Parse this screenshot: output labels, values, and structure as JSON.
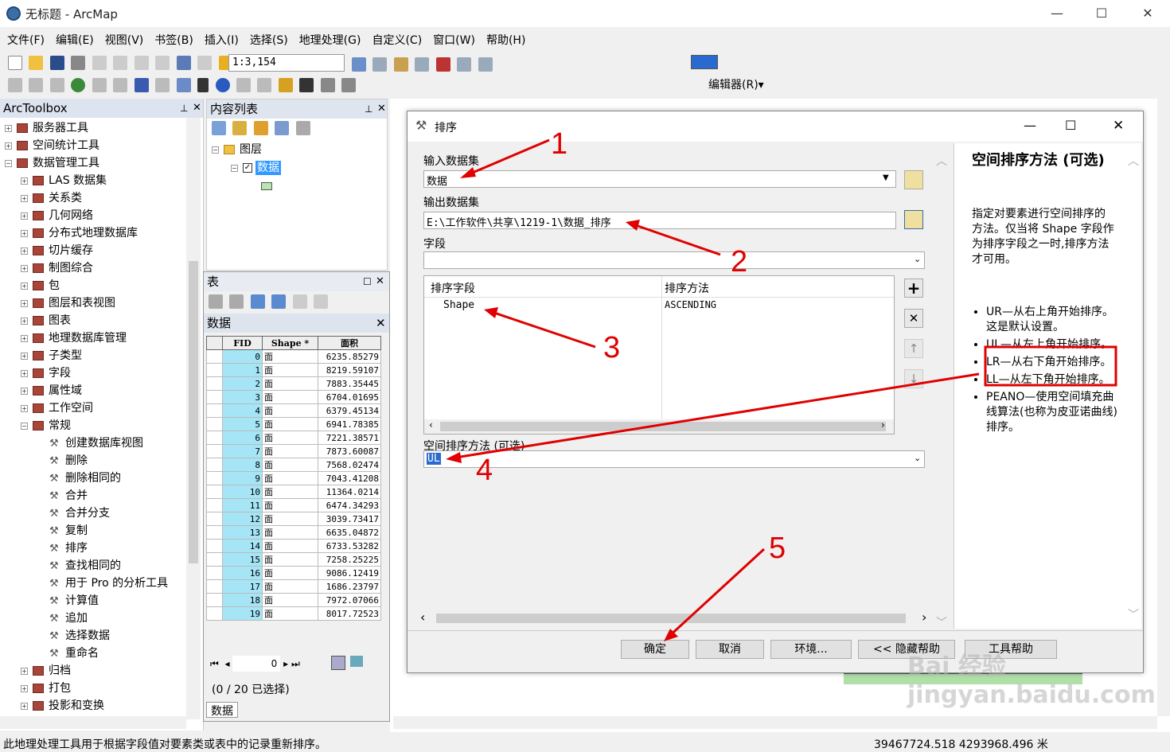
{
  "window": {
    "title": "无标题 - ArcMap",
    "min": "—",
    "max": "☐",
    "close": "✕"
  },
  "menu": [
    "文件(F)",
    "编辑(E)",
    "视图(V)",
    "书签(B)",
    "插入(I)",
    "选择(S)",
    "地理处理(G)",
    "自定义(C)",
    "窗口(W)",
    "帮助(H)"
  ],
  "toolbar": {
    "scale": "1:3,154",
    "editor": "编辑器(R)▾"
  },
  "toolbox": {
    "title": "ArcToolbox",
    "items": [
      {
        "label": "服务器工具",
        "kind": "box",
        "exp": "+"
      },
      {
        "label": "空间统计工具",
        "kind": "box",
        "exp": "+"
      },
      {
        "label": "数据管理工具",
        "kind": "box",
        "exp": "−"
      },
      {
        "label": "LAS 数据集",
        "kind": "box",
        "exp": "+"
      },
      {
        "label": "关系类",
        "kind": "box",
        "exp": "+"
      },
      {
        "label": "几何网络",
        "kind": "box",
        "exp": "+"
      },
      {
        "label": "分布式地理数据库",
        "kind": "box",
        "exp": "+"
      },
      {
        "label": "切片缓存",
        "kind": "box",
        "exp": "+"
      },
      {
        "label": "制图综合",
        "kind": "box",
        "exp": "+"
      },
      {
        "label": "包",
        "kind": "box",
        "exp": "+"
      },
      {
        "label": "图层和表视图",
        "kind": "box",
        "exp": "+"
      },
      {
        "label": "图表",
        "kind": "box",
        "exp": "+"
      },
      {
        "label": "地理数据库管理",
        "kind": "box",
        "exp": "+"
      },
      {
        "label": "子类型",
        "kind": "box",
        "exp": "+"
      },
      {
        "label": "字段",
        "kind": "box",
        "exp": "+"
      },
      {
        "label": "属性域",
        "kind": "box",
        "exp": "+"
      },
      {
        "label": "工作空间",
        "kind": "box",
        "exp": "+"
      },
      {
        "label": "常规",
        "kind": "box",
        "exp": "−"
      },
      {
        "label": "创建数据库视图",
        "kind": "tool"
      },
      {
        "label": "删除",
        "kind": "tool"
      },
      {
        "label": "删除相同的",
        "kind": "tool"
      },
      {
        "label": "合并",
        "kind": "tool"
      },
      {
        "label": "合并分支",
        "kind": "tool"
      },
      {
        "label": "复制",
        "kind": "tool"
      },
      {
        "label": "排序",
        "kind": "tool"
      },
      {
        "label": "查找相同的",
        "kind": "tool"
      },
      {
        "label": "用于 Pro 的分析工具",
        "kind": "tool"
      },
      {
        "label": "计算值",
        "kind": "tool"
      },
      {
        "label": "追加",
        "kind": "tool"
      },
      {
        "label": "选择数据",
        "kind": "tool"
      },
      {
        "label": "重命名",
        "kind": "tool"
      },
      {
        "label": "归档",
        "kind": "box",
        "exp": "+"
      },
      {
        "label": "打包",
        "kind": "box",
        "exp": "+"
      },
      {
        "label": "投影和变换",
        "kind": "box",
        "exp": "+"
      }
    ]
  },
  "toc": {
    "title": "内容列表",
    "layers": "图层",
    "layer": "数据"
  },
  "table": {
    "title": "表",
    "tab_title": "数据",
    "columns": [
      "FID",
      "Shape *",
      "面积"
    ],
    "rows": [
      [
        "0",
        "面",
        "6235.85279"
      ],
      [
        "1",
        "面",
        "8219.59107"
      ],
      [
        "2",
        "面",
        "7883.35445"
      ],
      [
        "3",
        "面",
        "6704.01695"
      ],
      [
        "4",
        "面",
        "6379.45134"
      ],
      [
        "5",
        "面",
        "6941.78385"
      ],
      [
        "6",
        "面",
        "7221.38571"
      ],
      [
        "7",
        "面",
        "7873.60087"
      ],
      [
        "8",
        "面",
        "7568.02474"
      ],
      [
        "9",
        "面",
        "7043.41208"
      ],
      [
        "10",
        "面",
        "11364.0214"
      ],
      [
        "11",
        "面",
        "6474.34293"
      ],
      [
        "12",
        "面",
        "3039.73417"
      ],
      [
        "13",
        "面",
        "6635.04872"
      ],
      [
        "14",
        "面",
        "6733.53282"
      ],
      [
        "15",
        "面",
        "7258.25225"
      ],
      [
        "16",
        "面",
        "9086.12419"
      ],
      [
        "17",
        "面",
        "1686.23797"
      ],
      [
        "18",
        "面",
        "7972.07066"
      ],
      [
        "19",
        "面",
        "8017.72523"
      ]
    ],
    "record": "0",
    "selection": "(0 / 20 已选择)",
    "bottom_tab": "数据"
  },
  "dialog": {
    "title": "排序",
    "input_label": "输入数据集",
    "input_value": "数据",
    "output_label": "输出数据集",
    "output_value": "E:\\工作软件\\共享\\1219-1\\数据_排序",
    "field_label": "字段",
    "sort_col1": "排序字段",
    "sort_col2": "排序方法",
    "sort_field": "Shape",
    "sort_method": "ASCENDING",
    "spatial_label": "空间排序方法 (可选)",
    "spatial_value": "UL",
    "buttons": {
      "ok": "确定",
      "cancel": "取消",
      "env": "环境...",
      "hide": "<< 隐藏帮助",
      "help": "工具帮助"
    }
  },
  "help": {
    "title": "空间排序方法 (可选)",
    "desc": "指定对要素进行空间排序的方法。仅当将 Shape 字段作为排序字段之一时,排序方法才可用。",
    "bullets": [
      "UR—从右上角开始排序。这是默认设置。",
      "UL—从左上角开始排序。",
      "LR—从右下角开始排序。",
      "LL—从左下角开始排序。",
      "PEANO—使用空间填充曲线算法(也称为皮亚诺曲线)排序。"
    ]
  },
  "annotations": [
    "1",
    "2",
    "3",
    "4",
    "5"
  ],
  "status": {
    "message": "此地理处理工具用于根据字段值对要素类或表中的记录重新排序。",
    "coords": "39467724.518  4293968.496 米"
  },
  "watermark": "Bai 经验 jingyan.baidu.com",
  "colors": {
    "annotation": "#e00000",
    "fid_cell": "#a6e5f5",
    "selected": "#3399ff"
  }
}
